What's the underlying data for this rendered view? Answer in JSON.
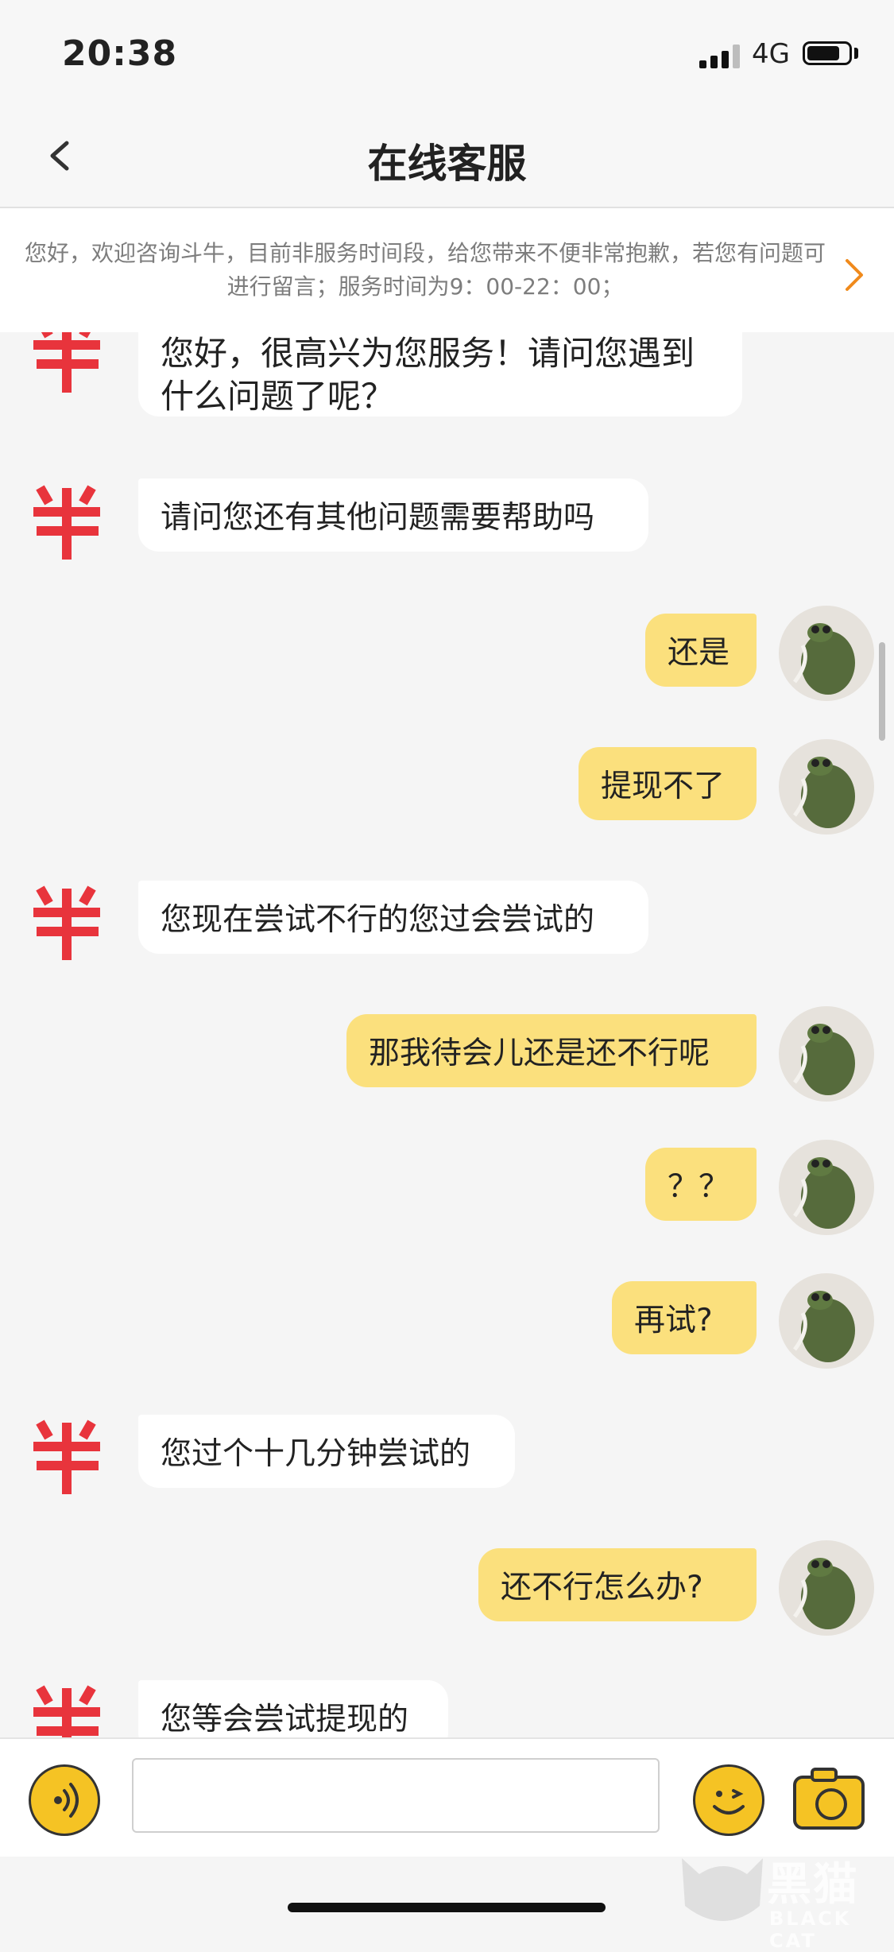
{
  "status_bar": {
    "time": "20:38",
    "network": "4G",
    "battery_level": 0.8
  },
  "nav": {
    "title": "在线客服"
  },
  "notice": {
    "text": "您好，欢迎咨询斗牛，目前非服务时间段，给您带来不便非常抱歉，若您有问题可进行留言；服务时间为9：00-22：00；"
  },
  "messages": [
    {
      "side": "agent",
      "text": "您好，很高兴为您服务！请问您遇到什么问题了呢？"
    },
    {
      "side": "agent",
      "text": "请问您还有其他问题需要帮助吗"
    },
    {
      "side": "user",
      "text": "还是"
    },
    {
      "side": "user",
      "text": "提现不了"
    },
    {
      "side": "agent",
      "text": "您现在尝试不行的您过会尝试的"
    },
    {
      "side": "user",
      "text": "那我待会儿还是还不行呢"
    },
    {
      "side": "user",
      "text": "？？"
    },
    {
      "side": "user",
      "text": "再试?"
    },
    {
      "side": "agent",
      "text": "您过个十几分钟尝试的"
    },
    {
      "side": "user",
      "text": "还不行怎么办?"
    },
    {
      "side": "agent",
      "text": "您等会尝试提现的"
    }
  ],
  "input": {
    "value": "",
    "placeholder": ""
  },
  "colors": {
    "user_bubble": "#fbe07d",
    "agent_bubble": "#ffffff",
    "accent": "#f5c324",
    "agent_logo": "#e8343c"
  },
  "icons": {
    "back": "chevron-left-icon",
    "notice_arrow": "chevron-right-icon",
    "voice": "voice-icon",
    "emoji": "smiley-icon",
    "camera": "camera-icon"
  },
  "watermark": {
    "text": "黑猫",
    "sub": "BLACK CAT"
  }
}
